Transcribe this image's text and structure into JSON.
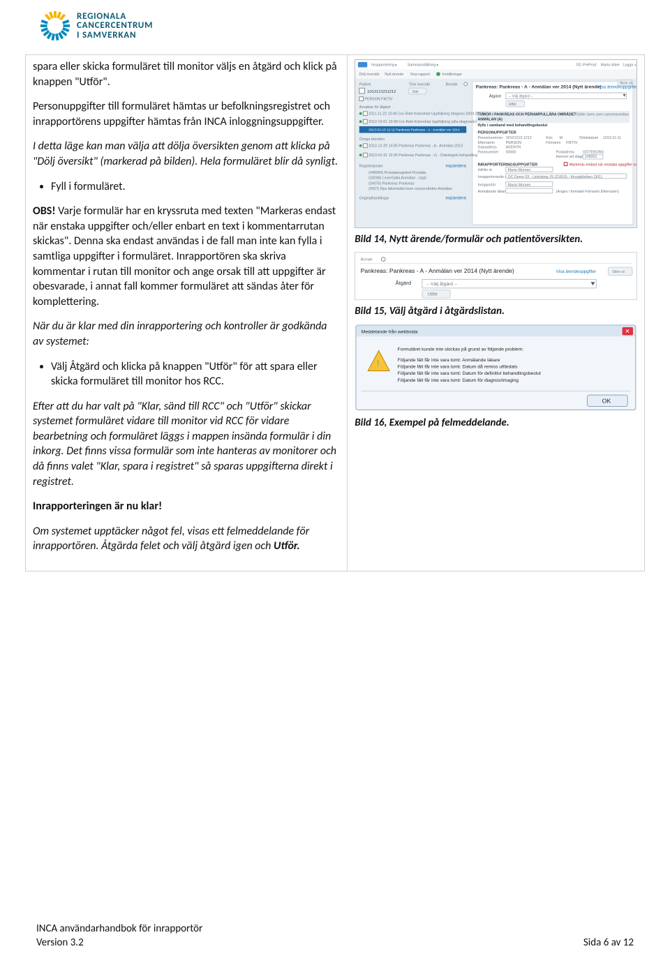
{
  "header": {
    "line1": "REGIONALA",
    "line2": "CANCERCENTRUM",
    "line3": "I SAMVERKAN"
  },
  "left": {
    "p1": "spara eller skicka formuläret till monitor väljs en åtgärd och klick på knappen \"Utför\".",
    "p2": "Personuppgifter till formuläret hämtas ur befolkningsregistret och inrapportörens uppgifter hämtas från INCA inloggningsuppgifter.",
    "p3": "I detta läge kan man välja att dölja översikten genom att klicka på \"Dölj översikt\" (markerad på bilden). Hela formuläret blir då synligt.",
    "bullet1": "Fyll i formuläret.",
    "p4_lead": "OBS!",
    "p4_rest": " Varje formulär har en kryssruta med texten \"Markeras endast när enstaka uppgifter och/eller enbart en text i kommentarrutan skickas\". Denna ska endast användas i de fall man inte kan fylla i samtliga uppgifter i formuläret. Inrapportören ska skriva kommentar i rutan till monitor och ange orsak till att uppgifter är obesvarade, i annat fall kommer formuläret att sändas åter för komplettering.",
    "p5": "När du är klar med din inrapportering och kontroller är godkända av systemet:",
    "bullet2": "Välj Åtgärd och klicka på knappen \"Utför\" för att spara eller skicka formuläret till monitor hos RCC.",
    "p6": "Efter att du har valt på \"Klar, sänd till RCC\" och \"Utför\" skickar systemet formuläret vidare till monitor vid RCC för vidare bearbetning och formuläret läggs i mappen insända formulär i din inkorg. Det finns vissa formulär som inte hanteras av monitorer och då finns valet \"Klar, spara i registret\" så sparas uppgifterna direkt i registret.",
    "p7": "Inrapporteringen är nu klar!",
    "p8_a": "Om systemet upptäcker något fel, visas ett felmeddelande för inrapportören. Åtgärda felet och välj åtgärd igen och ",
    "p8_b": "Utför."
  },
  "right": {
    "cap14": "Bild 14, Nytt ärende/formulär och patientöversikten.",
    "cap15": "Bild 15, Välj åtgärd i åtgärdslistan.",
    "cap16": "Bild 16, Exempel på felmeddelande."
  },
  "shot1": {
    "top_links": [
      "OC-PreProd",
      "Maria slider",
      "Logga ut"
    ],
    "tabs": [
      "Dölj översikt",
      "Nytt ärende",
      "Visa rapport",
      "Inställningar"
    ],
    "patient_label": "Patient",
    "tom_label": "Töm översikt",
    "arendel": "Ärende",
    "personnr": "1012121211212",
    "sok": "Sök",
    "personfiktiv": "PERSON FIKTIV",
    "title": "Pankreas: Pankreas - A - Anmälan ver 2014 (Nytt ärende)",
    "showlink": "Visa ärendeuppgifter",
    "print": "Skriv ut",
    "avvakta": "Avvaktar för åtgärd",
    "atgard": "Åtgärd",
    "valj": "-- Välj åtgärd --",
    "utfor": "Utför",
    "hist": [
      "2011-11-22 10:46 Cor-Rekt Kolorektal Uppföljning (diagnos 2004-2010)",
      "2012-10-01 10:48 Cor-Rekt Kolorektal Uppföljning (alla diagnosår)",
      "2013-02-10 12:12 Pankreas Pankreas - A - Anmälan ver 2014"
    ],
    "ovriga": "Övriga ärenden",
    "ovrigh": [
      "2012-12-20 14:05 Pankreas Pankreas - A - Anmälan 2013",
      "2013-01-31 10:35 Pankreas Pankreas - G - Onkologisk behandling"
    ],
    "regposter": "Registerposter",
    "expandera": "expandera",
    "reglist": [
      "(448054) Prostataregistret Prostata",
      "(18268) LeverGalla Anmälan - Uppl",
      "(34075) Pankreas Pankreas",
      "(4027) Nya läkemedel inom cancervården Anmälan"
    ],
    "orig": "Originalhandlingar",
    "tumor_h1": "TUMÖR I PANKREAS OCH PERIAMPULLÄRA OMRÅDET",
    "tumor_h2": "ANMÄLAN (A)",
    "tumor_sub": "Gäller även som canceranmälan",
    "tumor_note": "Ifylls i samband med behandlingsbeslut",
    "pu": "PERSONUPPGIFTER",
    "pu_rows": [
      [
        "Personnummer",
        "10121212-1212",
        "Kön",
        "M",
        "Dödsdatum",
        "1013-11-11"
      ],
      [
        "Efternamn",
        "PERSON",
        "Förnamn",
        "FIKTIV",
        "",
        ""
      ],
      [
        "Gatuadress",
        "AVENYN",
        "",
        "",
        "",
        ""
      ],
      [
        "Postnummer",
        "50000",
        "",
        "Postadress",
        "GÖTEBORG",
        ""
      ],
      [
        "",
        "",
        "",
        "Hemort vid diagnos",
        "148001",
        ""
      ]
    ],
    "inr": "INRAPPORTERINGSUPPGIFTER",
    "inifran": "Inifrån vt",
    "inname": "Maria Women",
    "inrep_enh": "Inrapporterande enhet",
    "enhet": "OC Demo 03 - Linköping JS (21810) - Kirurgkliniken (301)",
    "inrapporter": "Inrapportör",
    "inrname": "Maria Women",
    "anm": "Anmälande läkare",
    "anm_note2": "(Anges i formatet Förnamn Efternamn)",
    "warn": "Markeras endast när enstaka uppgifter och/eller enbart en text i kommentarrutan skickas"
  },
  "shot2": {
    "arendel": "Ärende",
    "title": "Pankreas: Pankreas - A - Anmälan ver 2014 (Nytt ärende)",
    "showlink": "Visa ärendeuppgifter",
    "print": "Skriv ut",
    "atgard": "Åtgärd",
    "valj": "-- Välj åtgärd --",
    "utfor": "Utför"
  },
  "shot3": {
    "title": "Meddelande från webbsida",
    "line1": "Formuläret kunde inte skickas på grund av följande problem:",
    "lines": [
      "Följande fält får inte vara tomt: Anmälande läkare",
      "Följande fält får inte vara tomt: Datum då remiss utfärdats",
      "Följande fält får inte vara tomt: Datum för definitivt behandlingsbeslut",
      "Följande fält får inte vara tomt: Datum för diagnos/imaging"
    ],
    "ok": "OK"
  },
  "footer": {
    "t1": "INCA användarhandbok för inrapportör",
    "t2": "Version 3.2",
    "t3": "Sida 6 av 12"
  }
}
